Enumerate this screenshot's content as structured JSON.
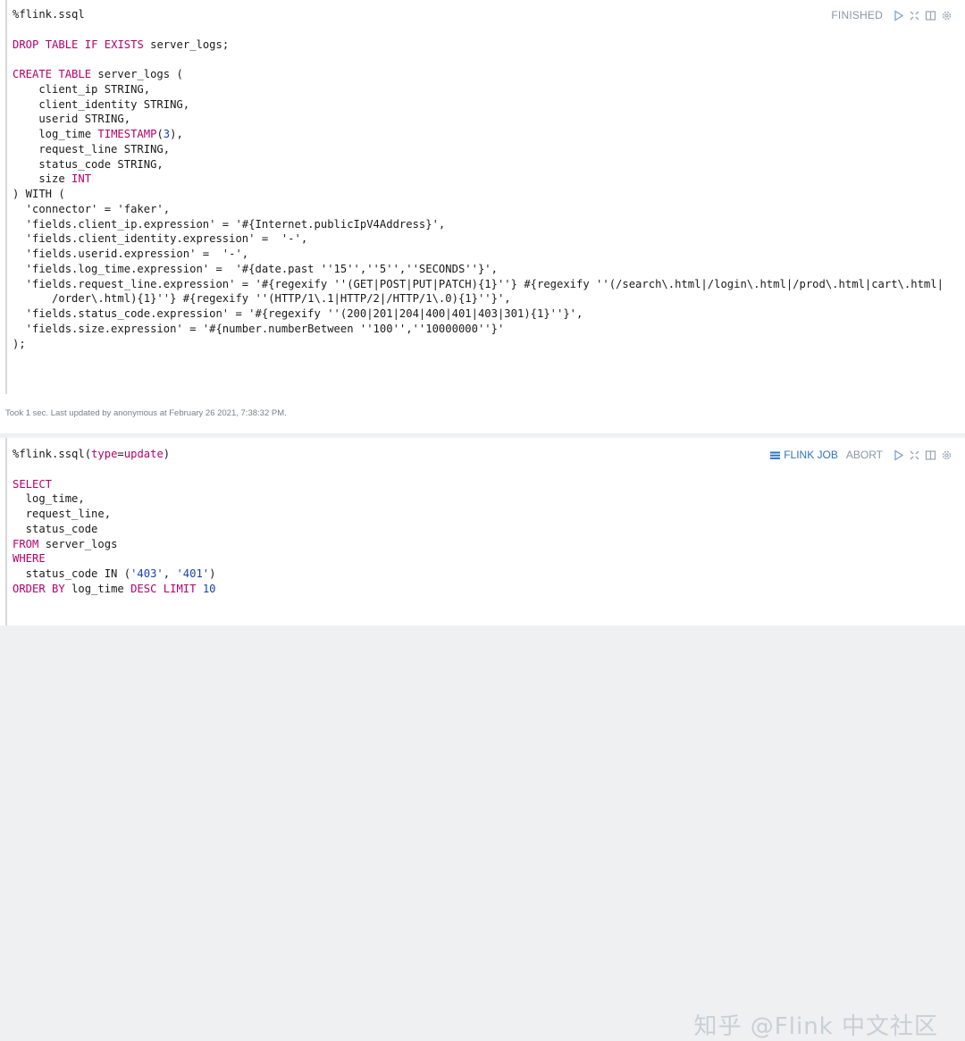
{
  "paragraph1": {
    "lines": [
      "%flink.ssql",
      "",
      "DROP TABLE IF EXISTS server_logs;",
      "",
      "CREATE TABLE server_logs (",
      "    client_ip STRING,",
      "    client_identity STRING,",
      "    userid STRING,",
      "    log_time TIMESTAMP(3),",
      "    request_line STRING,",
      "    status_code STRING,",
      "    size INT",
      ") WITH (",
      "  'connector' = 'faker',",
      "  'fields.client_ip.expression' = '#{Internet.publicIpV4Address}',",
      "  'fields.client_identity.expression' =  '-',",
      "  'fields.userid.expression' =  '-',",
      "  'fields.log_time.expression' =  '#{date.past ''15'',''5'',''SECONDS''}',",
      "  'fields.request_line.expression' = '#{regexify ''(GET|POST|PUT|PATCH){1}''} #{regexify ''(/search\\.html|/login\\.html|/prod\\.html|cart\\.html|",
      "      /order\\.html){1}''} #{regexify ''(HTTP/1\\.1|HTTP/2|/HTTP/1\\.0){1}''}',",
      "  'fields.status_code.expression' = '#{regexify ''(200|201|204|400|401|403|301){1}''}',",
      "  'fields.size.expression' = '#{number.numberBetween ''100'',''10000000''}'",
      ");"
    ],
    "status": "FINISHED",
    "footer": "Took 1 sec. Last updated by anonymous at February 26 2021, 7:38:32 PM."
  },
  "paragraph2": {
    "lines": [
      "%flink.ssql(type=update)",
      "",
      "SELECT",
      "  log_time,",
      "  request_line,",
      "  status_code",
      "FROM server_logs",
      "WHERE",
      "  status_code IN ('403', '401')",
      "ORDER BY log_time DESC LIMIT 10"
    ],
    "flink_job_label": "FLINK JOB",
    "abort_label": "ABORT"
  },
  "icons": [
    "run-icon",
    "expand-icon",
    "book-icon",
    "gear-icon",
    "list-icon"
  ],
  "colors": {
    "keyword": "#b5006b",
    "number": "#1a3fb0",
    "status": "#8a96a3",
    "link": "#2f74c0"
  },
  "watermark": "知乎 @Flink 中文社区"
}
